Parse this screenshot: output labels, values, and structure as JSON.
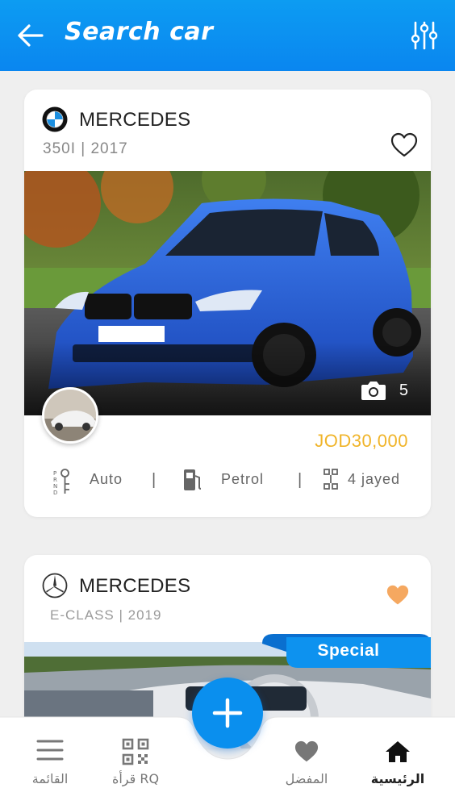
{
  "header": {
    "title": "Search car",
    "back_icon": "arrow-left-icon",
    "filter_icon": "sliders-icon"
  },
  "listings": [
    {
      "brand": "MERCEDES",
      "brand_logo": "bmw-logo-icon",
      "model_year": "350I | 2017",
      "favorite": false,
      "photo_count": "5",
      "price": "JOD30,000",
      "specs": {
        "transmission": "Auto",
        "fuel": "Petrol",
        "seats": "4 jayed"
      }
    },
    {
      "brand": "MERCEDES",
      "brand_logo": "mercedes-logo-icon",
      "model_year": "E-CLASS | 2019",
      "favorite": true,
      "badge": "Special"
    }
  ],
  "bottom_nav": {
    "items": [
      {
        "label": "القائمة",
        "icon": "menu-icon"
      },
      {
        "label": "قرأة RQ",
        "icon": "qr-code-icon"
      },
      {
        "label": "المفضل",
        "icon": "heart-icon"
      },
      {
        "label": "الرئيسية",
        "icon": "home-icon",
        "active": true
      }
    ],
    "fab_icon": "plus-icon"
  },
  "colors": {
    "primary": "#0a8fee",
    "price": "#f0b429",
    "favorite_active": "#f5a860",
    "background": "#efefef"
  }
}
